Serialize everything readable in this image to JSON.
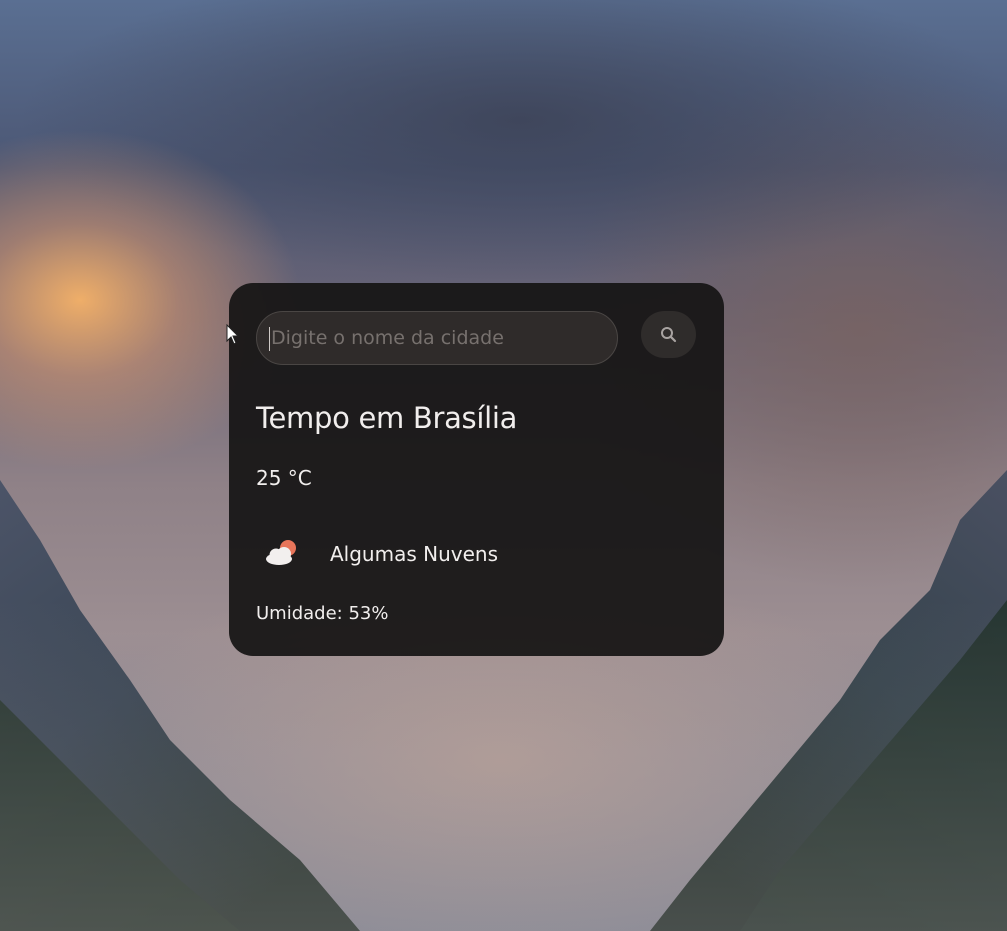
{
  "search": {
    "placeholder": "Digite o nome da cidade",
    "value": "",
    "button_icon": "search-icon"
  },
  "weather": {
    "title": "Tempo em Brasília",
    "temperature": "25 °C",
    "description": "Algumas Nuvens",
    "condition_icon": "partly-cloudy-icon",
    "humidity": "Umidade: 53%"
  },
  "colors": {
    "card_background": "#161414",
    "input_background": "#2f2b2a",
    "sun_accent": "#e8755a",
    "text": "#f1eeed"
  }
}
